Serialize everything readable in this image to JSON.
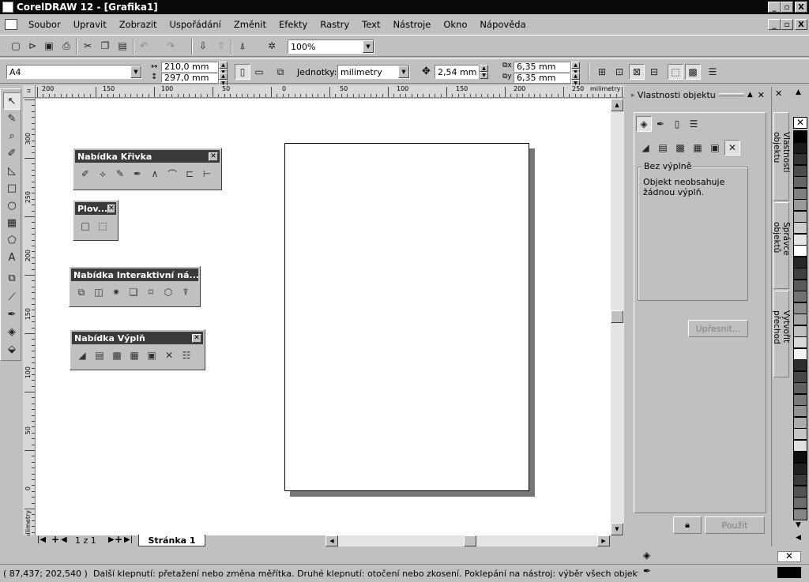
{
  "window": {
    "title": "CorelDRAW 12 - [Grafika1]",
    "controls": [
      "_",
      "▫",
      "X"
    ],
    "doc_controls": [
      "_",
      "▫",
      "X"
    ]
  },
  "menu": [
    "Soubor",
    "Upravit",
    "Zobrazit",
    "Uspořádání",
    "Změnit",
    "Efekty",
    "Rastry",
    "Text",
    "Nástroje",
    "Okno",
    "Nápověda"
  ],
  "standard_toolbar": {
    "zoom": "100%"
  },
  "property_bar": {
    "paper": "A4",
    "width": "210,0 mm",
    "height": "297,0 mm",
    "units_label": "Jednotky:",
    "units_value": "milimetry",
    "nudge": "2,54 mm",
    "dup_x": "6,35 mm",
    "dup_y": "6,35 mm"
  },
  "rulers": {
    "unit": "milimetry",
    "h_labels": [
      "200",
      "150",
      "100",
      "50",
      "0",
      "50",
      "100",
      "150",
      "200",
      "250"
    ],
    "v_labels": [
      "300",
      "250",
      "200",
      "150",
      "100",
      "50",
      "0"
    ],
    "v_unit": "milimetry"
  },
  "flyouts": {
    "curve": "Nabídka Křivka",
    "float": "Plov...",
    "interactive": "Nabídka Interaktivní ná...",
    "fill": "Nabídka Výplň"
  },
  "page_nav": {
    "counter": "1 z 1",
    "page_tab": "Stránka 1"
  },
  "docker": {
    "title": "Vlastnosti objektu",
    "group_label": "Bez výplně",
    "description": "Objekt neobsahuje žádnou výplň.",
    "refine_button": "Upřesnit...",
    "apply_button": "Použít"
  },
  "right_tabs": [
    "Vlastnosti objektu",
    "Správce objektů",
    "Vytvořit přechod"
  ],
  "palette": [
    "#000000",
    "#1a1a1a",
    "#333333",
    "#4d4d4d",
    "#666666",
    "#808080",
    "#999999",
    "#b3b3b3",
    "#cccccc",
    "#e6e6e6",
    "#ffffff",
    "#262626",
    "#404040",
    "#595959",
    "#737373",
    "#8c8c8c",
    "#a6a6a6",
    "#bfbfbf",
    "#d9d9d9",
    "#f2f2f2",
    "#2e2e2e",
    "#474747",
    "#606060",
    "#7a7a7a",
    "#939393",
    "#adadad",
    "#c6c6c6",
    "#e0e0e0",
    "#0d0d0d",
    "#202020",
    "#3a3a3a",
    "#535353",
    "#6d6d6d",
    "#868686"
  ],
  "status": {
    "coords": "( 87,437; 202,540 )",
    "hint": "Další klepnutí: přetažení nebo změna měřítka. Druhé klepnutí: otočení  nebo zkosení. Poklepání na nástroj: výběr všech objektů. Klávesa Shift ..."
  }
}
